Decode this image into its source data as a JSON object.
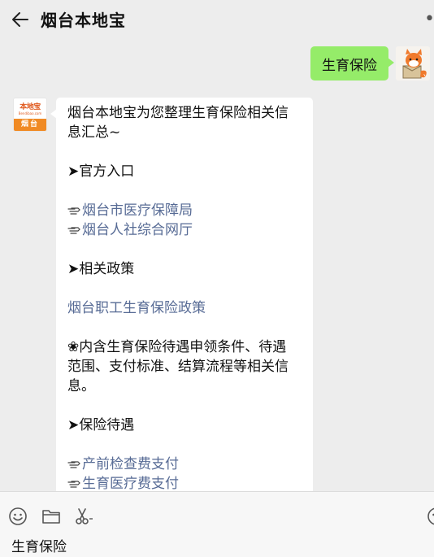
{
  "header": {
    "title": "烟台本地宝"
  },
  "my_message": {
    "text": "生育保险"
  },
  "bot": {
    "avatar_logo": "本地宝",
    "avatar_url": "Bendibao.com",
    "avatar_city": "烟台",
    "intro_line1": "烟台本地宝为您整理生育保险相关信",
    "intro_line2": "息汇总~",
    "section1": "➤官方入口",
    "link1": "烟台市医疗保障局",
    "link2": "烟台人社综合网厅",
    "section2": "➤相关政策",
    "link3": "烟台职工生育保险政策",
    "note_line1": "❀内含生育保险待遇申领条件、待遇",
    "note_line2": "范围、支付标准、结算流程等相关信",
    "note_line3": "息。",
    "section3": "➤保险待遇",
    "link4": "产前检查费支付",
    "link5": "生育医疗费支付"
  },
  "input": {
    "value": "生育保险"
  },
  "icons": [
    "back-arrow-icon",
    "more-icon",
    "emoji-icon",
    "folder-icon",
    "scissors-icon",
    "smiley-icon",
    "pointing-hand-icon"
  ],
  "colors": {
    "my_bubble": "#95ec69",
    "link": "#576b95",
    "logo": "#f08a24"
  }
}
